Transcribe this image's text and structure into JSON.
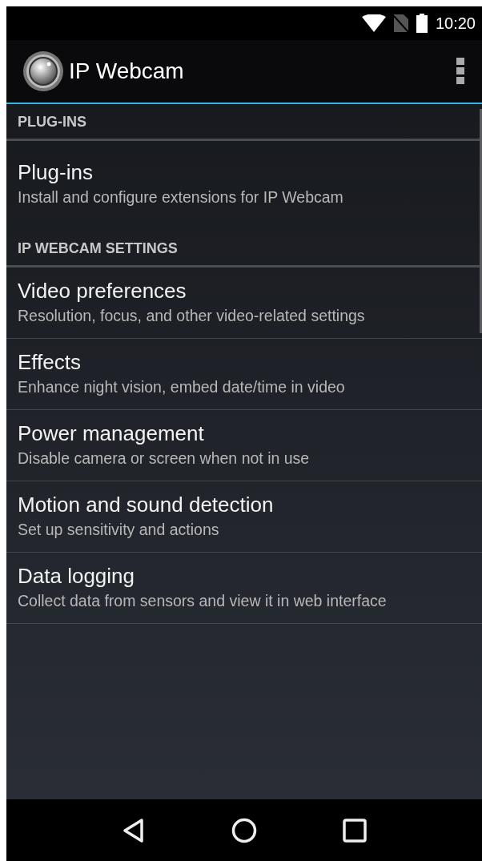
{
  "status_bar": {
    "time": "10:20"
  },
  "app_bar": {
    "title": "IP Webcam"
  },
  "sections": [
    {
      "header": "PLUG-INS",
      "items": [
        {
          "title": "Plug-ins",
          "subtitle": "Install and configure extensions for IP Webcam"
        }
      ]
    },
    {
      "header": "IP WEBCAM SETTINGS",
      "items": [
        {
          "title": "Video preferences",
          "subtitle": "Resolution, focus, and other video-related settings"
        },
        {
          "title": "Effects",
          "subtitle": "Enhance night vision, embed date/time in video"
        },
        {
          "title": "Power management",
          "subtitle": "Disable camera or screen when not in use"
        },
        {
          "title": "Motion and sound detection",
          "subtitle": "Set up sensitivity and actions"
        },
        {
          "title": "Data logging",
          "subtitle": "Collect data from sensors and view it in web interface"
        }
      ]
    }
  ]
}
